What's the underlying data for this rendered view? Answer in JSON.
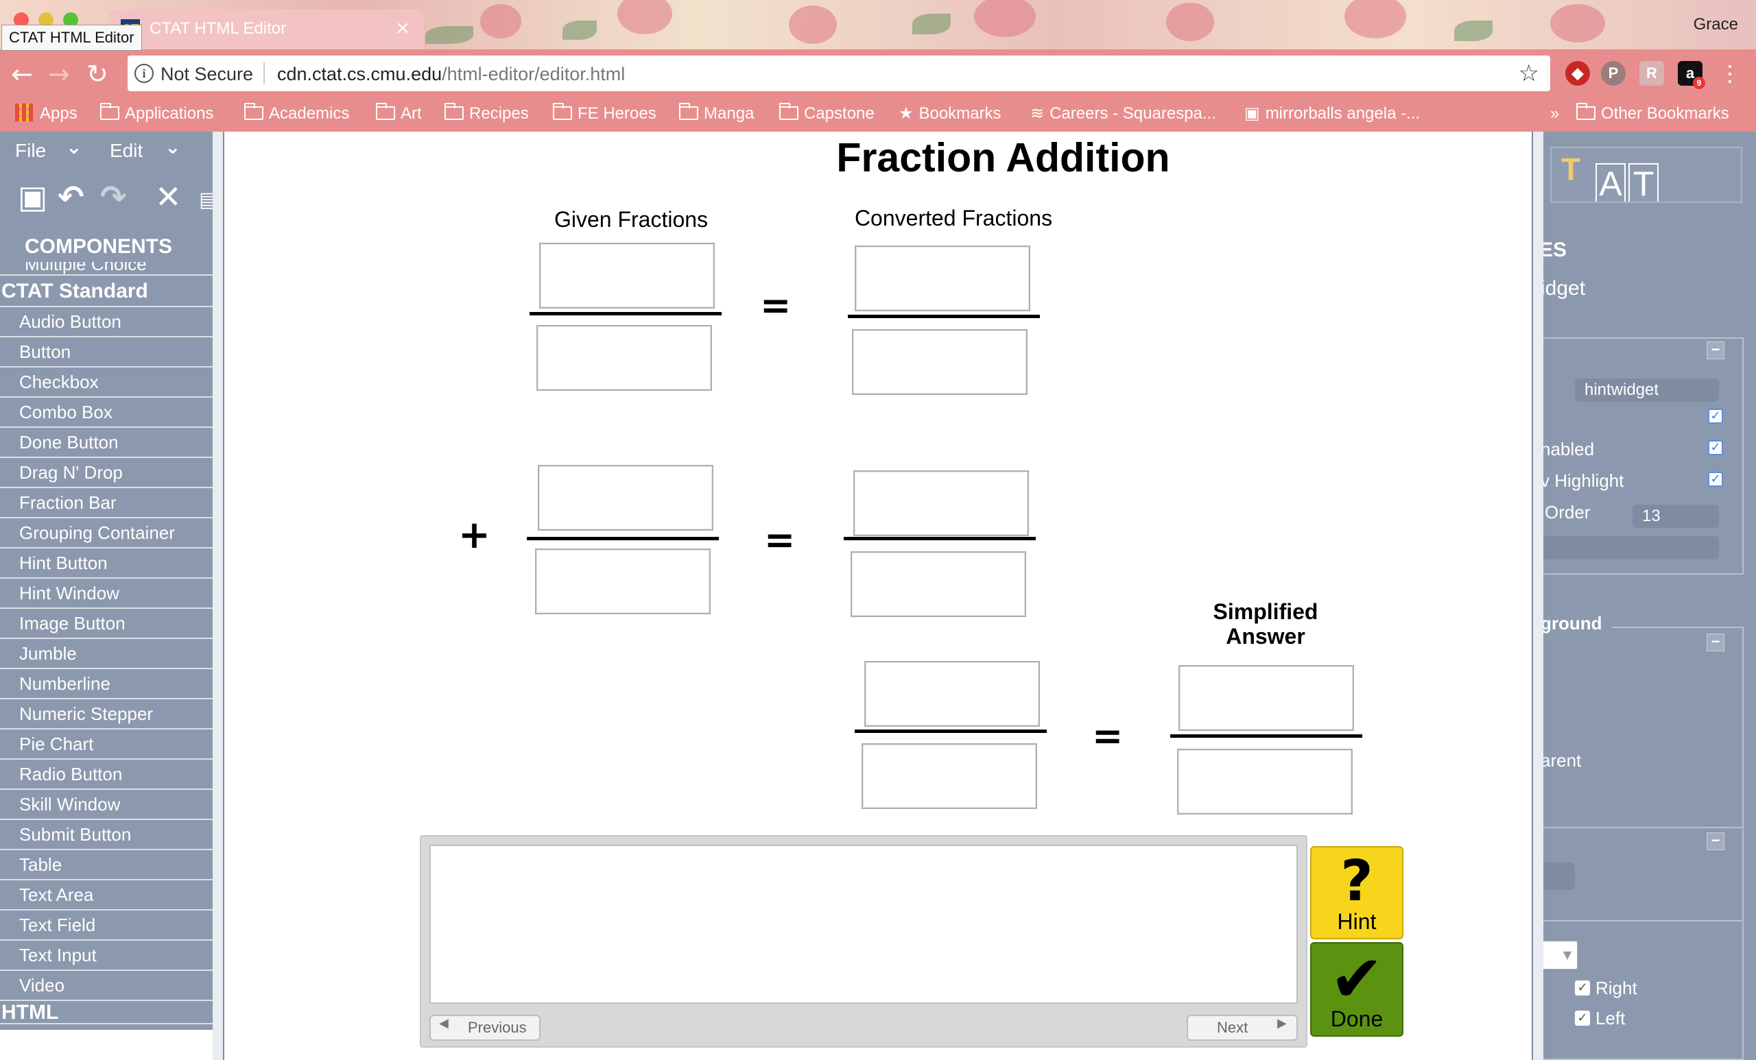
{
  "browser": {
    "tab_title": "CTAT HTML Editor",
    "tab_favicon": "CT",
    "tooltip": "CTAT HTML Editor",
    "profile_name": "Grace",
    "security_label": "Not Secure",
    "url_host": "cdn.ctat.cs.cmu.edu",
    "url_path": "/html-editor/editor.html",
    "extensions": [
      "ublock-icon",
      "pinterest-icon",
      "extension-icon",
      "amazon-icon"
    ],
    "extension_badge": "9",
    "bookmarks": {
      "apps": "Apps",
      "applications": "Applications",
      "academics": "Academics",
      "art": "Art",
      "recipes": "Recipes",
      "fe_heroes": "FE Heroes",
      "manga": "Manga",
      "capstone": "Capstone",
      "bookmarks": "Bookmarks",
      "careers": "Careers - Squarespa...",
      "mirrorballs": "mirrorballs angela -...",
      "overflow": "»",
      "other": "Other Bookmarks"
    }
  },
  "left_panel": {
    "menu_file": "File",
    "menu_edit": "Edit",
    "components_header": "COMPONENTS",
    "cut_item": "Multiple Choice",
    "category_standard": "CTAT Standard",
    "components": [
      "Audio Button",
      "Button",
      "Checkbox",
      "Combo Box",
      "Done Button",
      "Drag N' Drop",
      "Fraction Bar",
      "Grouping Container",
      "Hint Button",
      "Hint Window",
      "Image Button",
      "Jumble",
      "Numberline",
      "Numeric Stepper",
      "Pie Chart",
      "Radio Button",
      "Skill Window",
      "Submit Button",
      "Table",
      "Text Area",
      "Text Field",
      "Text Input",
      "Video"
    ],
    "category_html": "HTML"
  },
  "right_panel": {
    "section_partial": "ES",
    "widget_partial": "idget",
    "id_value": "hintwidget",
    "enabled_label": "nabled",
    "highlight_label": "v Highlight",
    "order_label": "Order",
    "order_value": "13",
    "background_label": "ground",
    "parent_label": "arent",
    "right_label": "Right",
    "left_label": "Left",
    "minimize": "−"
  },
  "canvas": {
    "title": "Fraction Addition",
    "given_label": "Given Fractions",
    "converted_label": "Converted Fractions",
    "simplified_label_line1": "Simplified",
    "simplified_label_line2": "Answer",
    "equals": "=",
    "plus": "+",
    "hint_previous": "Previous",
    "hint_next": "Next",
    "hint_button": "Hint",
    "hint_symbol": "?",
    "done_button": "Done",
    "done_symbol": "✔"
  }
}
